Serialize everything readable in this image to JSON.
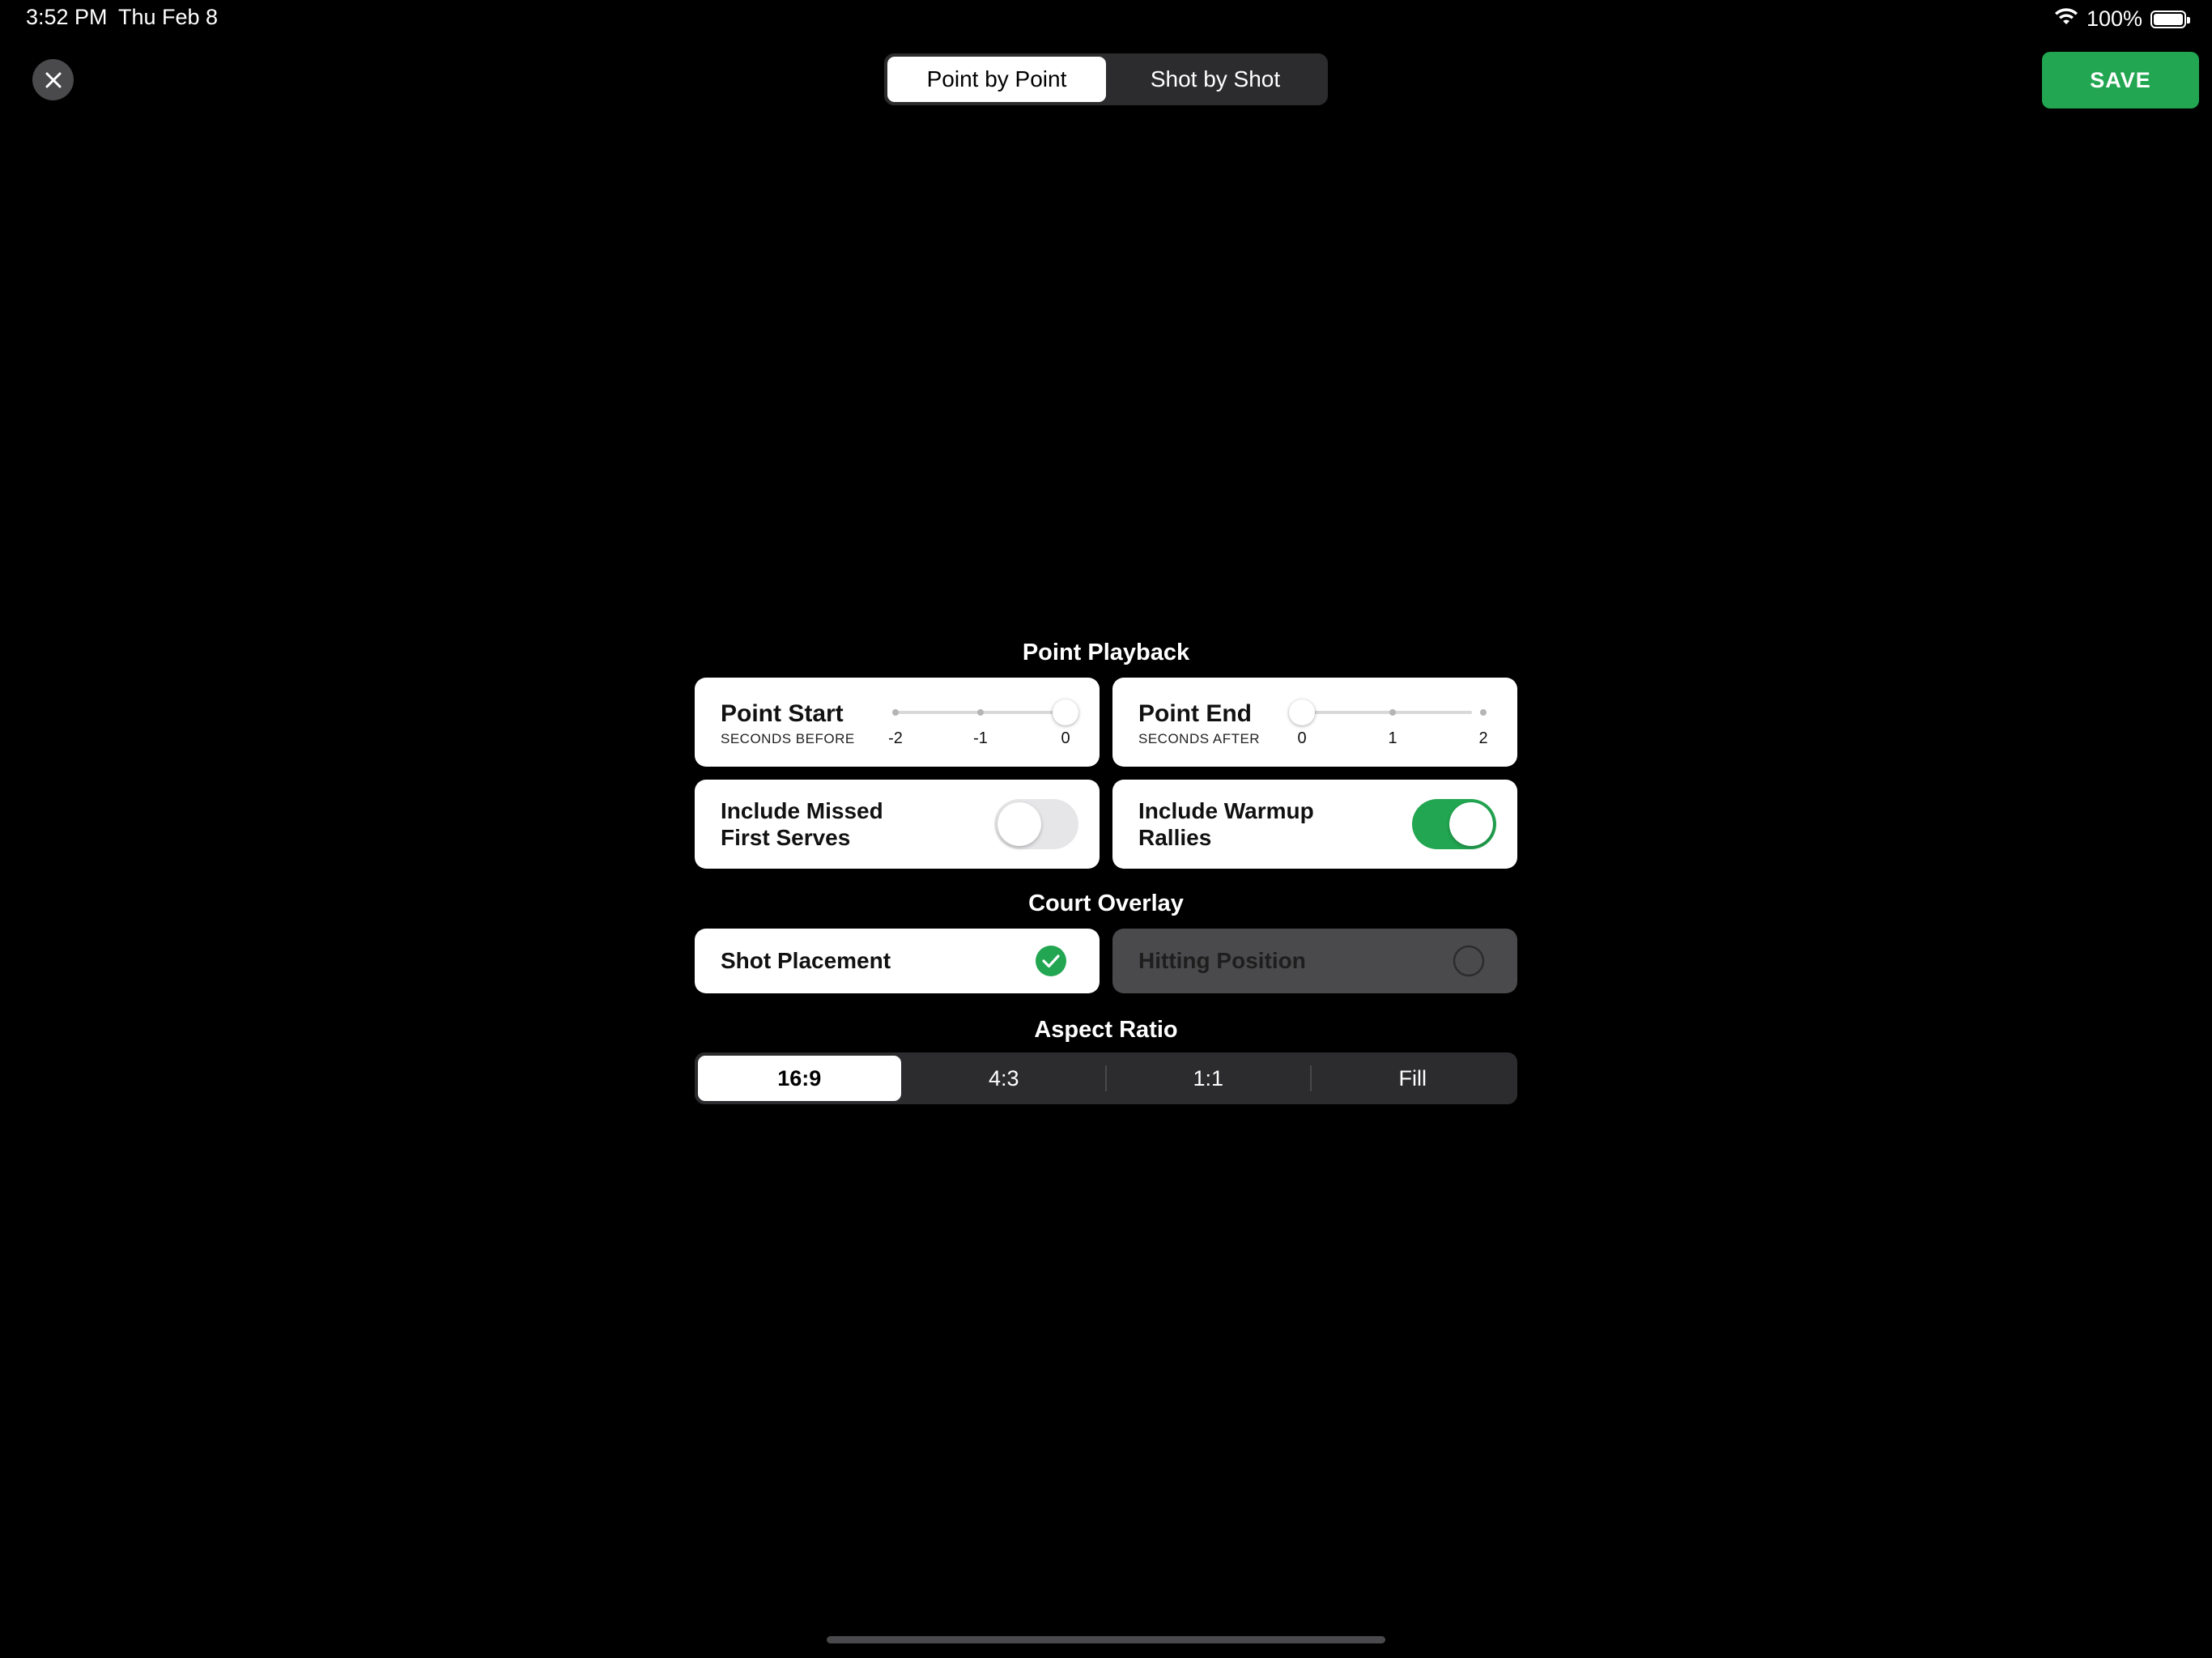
{
  "status_bar": {
    "time": "3:52 PM",
    "date": "Thu Feb 8",
    "battery": "100%",
    "icons": [
      "wifi-icon",
      "battery-icon"
    ]
  },
  "top_bar": {
    "close_icon": "close-icon",
    "modes": [
      {
        "label": "Point by Point",
        "selected": true
      },
      {
        "label": "Shot by Shot",
        "selected": false
      }
    ],
    "save_label": "SAVE"
  },
  "point_playback": {
    "title": "Point Playback",
    "start": {
      "title": "Point Start",
      "subtitle": "SECONDS BEFORE",
      "ticks": [
        "-2",
        "-1",
        "0"
      ],
      "value": 0
    },
    "end": {
      "title": "Point End",
      "subtitle": "SECONDS AFTER",
      "ticks": [
        "0",
        "1",
        "2"
      ],
      "value": 0
    },
    "missed_first_serves": {
      "label_line1": "Include Missed",
      "label_line2": "First Serves",
      "on": false
    },
    "warmup_rallies": {
      "label_line1": "Include Warmup",
      "label_line2": "Rallies",
      "on": true
    }
  },
  "court_overlay": {
    "title": "Court Overlay",
    "options": [
      {
        "label": "Shot Placement",
        "selected": true
      },
      {
        "label": "Hitting Position",
        "selected": false
      }
    ]
  },
  "aspect_ratio": {
    "title": "Aspect Ratio",
    "options": [
      "16:9",
      "4:3",
      "1:1",
      "Fill"
    ],
    "selected": "16:9"
  },
  "colors": {
    "accent_green": "#22a651",
    "background": "#000000",
    "segment_bg": "#2c2c2e"
  }
}
